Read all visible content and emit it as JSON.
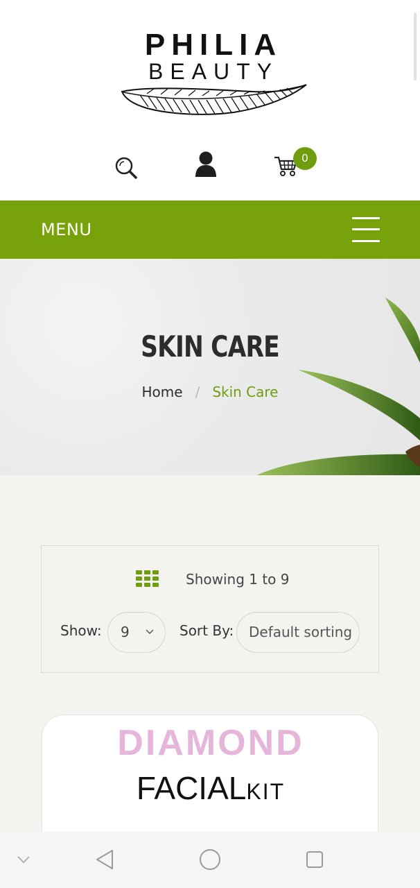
{
  "header": {
    "logo_line1": "PHILIA",
    "logo_line2": "BEAUTY",
    "cart_count": "0",
    "icons": [
      "search-icon",
      "account-icon",
      "cart-icon"
    ]
  },
  "menubar": {
    "label": "MENU",
    "background": "#78a209"
  },
  "banner": {
    "title": "SKIN CARE",
    "breadcrumb": {
      "home": "Home",
      "separator": "/",
      "current": "Skin Care"
    }
  },
  "toolbar": {
    "showing_text": "Showing 1 to 9",
    "show_label": "Show:",
    "show_value": "9",
    "sort_label": "Sort By:",
    "sort_value": "Default sorting"
  },
  "products": [
    {
      "image_text_line1": "DIAMOND",
      "image_text_line2a": "FACIAL",
      "image_text_line2b": "KIT"
    }
  ],
  "theme": {
    "accent": "#6f9d10",
    "page_bg": "#f4f3f0"
  },
  "system_nav": [
    "collapse-icon",
    "back-icon",
    "home-icon",
    "recents-icon"
  ]
}
